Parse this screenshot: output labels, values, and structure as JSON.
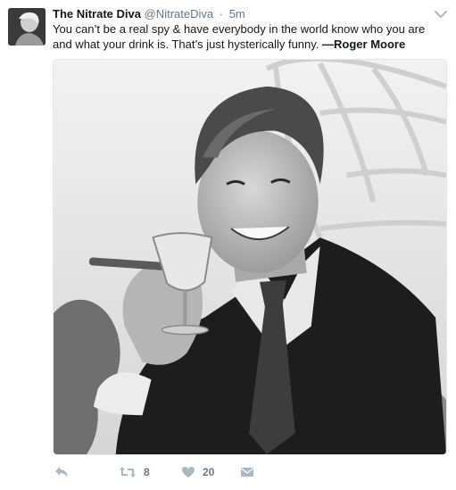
{
  "tweet": {
    "fullname": "The Nitrate Diva",
    "handle": "@NitrateDiva",
    "separator": "·",
    "time": "5m",
    "text_main": "You can’t be a real spy & have everybody in the world know who you are and what your drink is. That’s just hysterically funny. ",
    "text_attribution": "—Roger Moore"
  },
  "actions": {
    "retweet_count": "8",
    "like_count": "20"
  },
  "colors": {
    "text": "#14171a",
    "secondary": "#657786",
    "icon": "#aab8c2",
    "border": "#e1e8ed"
  },
  "icons": [
    "reply-icon",
    "retweet-icon",
    "like-icon",
    "direct-message-icon",
    "chevron-down-icon"
  ]
}
